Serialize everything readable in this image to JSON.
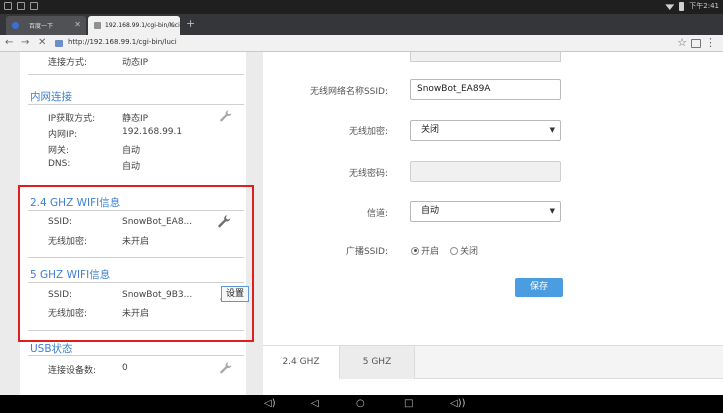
{
  "status_bar": {
    "time": "下午2:41"
  },
  "browser": {
    "tabs": [
      {
        "label": "百度一下"
      },
      {
        "label": "192.168.99.1/cgi-bin/luci"
      }
    ],
    "url": "http://192.168.99.1/cgi-bin/luci"
  },
  "left": {
    "wan": {
      "label": "连接方式:",
      "value": "动态IP"
    },
    "lan": {
      "title": "内网连接",
      "rows": [
        {
          "label": "IP获取方式:",
          "value": "静态IP"
        },
        {
          "label": "内网IP:",
          "value": "192.168.99.1"
        },
        {
          "label": "网关:",
          "value": "自动"
        },
        {
          "label": "DNS:",
          "value": "自动"
        }
      ]
    },
    "wifi24": {
      "title": "2.4 GHZ WIFI信息",
      "rows": [
        {
          "label": "SSID:",
          "value": "SnowBot_EA8..."
        },
        {
          "label": "无线加密:",
          "value": "未开启"
        }
      ]
    },
    "wifi5": {
      "title": "5 GHZ WIFI信息",
      "rows": [
        {
          "label": "SSID:",
          "value": "SnowBot_9B3..."
        },
        {
          "label": "无线加密:",
          "value": "未开启"
        }
      ]
    },
    "usb": {
      "title": "USB状态",
      "rows": [
        {
          "label": "连接设备数:",
          "value": "0"
        }
      ]
    },
    "tooltip": "设置"
  },
  "form": {
    "ssid_label": "无线网络名称SSID:",
    "ssid_value": "SnowBot_EA89A",
    "encryption_label": "无线加密:",
    "encryption_value": "关闭",
    "password_label": "无线密码:",
    "channel_label": "信道:",
    "channel_value": "自动",
    "broadcast_label": "广播SSID:",
    "broadcast_on": "开启",
    "broadcast_off": "关闭",
    "broadcast_selected": "开启",
    "save": "保存"
  },
  "band_tabs": [
    {
      "label": "2.4 GHZ"
    },
    {
      "label": "5 GHZ"
    }
  ],
  "colors": {
    "accent": "#3f7fcf",
    "highlight_box": "#e11e1e",
    "save_button": "#4a9de0"
  }
}
